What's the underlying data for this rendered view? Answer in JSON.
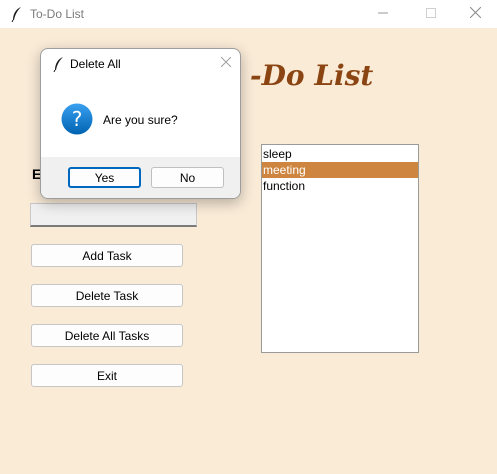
{
  "window": {
    "title": "To-Do List",
    "app_icon": "feather-icon",
    "controls": [
      "minimize-icon",
      "maximize-icon",
      "close-icon"
    ]
  },
  "main": {
    "heading": "-Do List",
    "enter_label": "E",
    "task_entry_value": "",
    "buttons": {
      "add": "Add Task",
      "delete": "Delete Task",
      "delete_all": "Delete All Tasks",
      "exit": "Exit"
    },
    "tasks": [
      "sleep",
      "meeting",
      "function"
    ],
    "selected_task": "meeting"
  },
  "dialog": {
    "title": "Delete All",
    "icon": "question-icon",
    "message": "Are you sure?",
    "buttons": {
      "yes": "Yes",
      "no": "No"
    }
  },
  "colors": {
    "background": "#faebd7",
    "heading": "#8b4513",
    "selection": "#cd853f",
    "dialog_accent": "#0067c0"
  }
}
